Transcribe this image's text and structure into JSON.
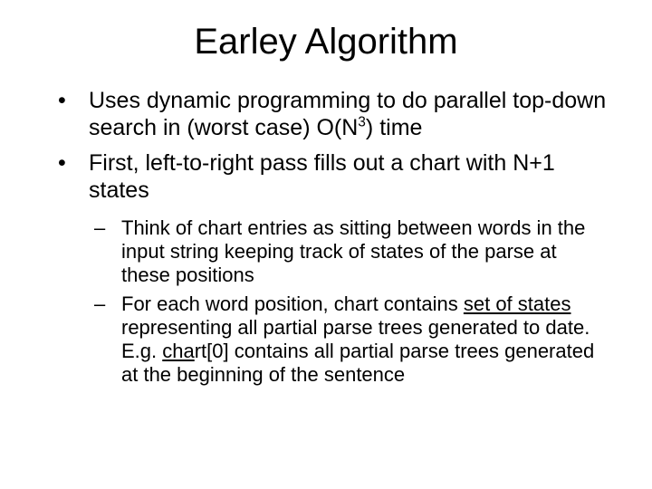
{
  "title": "Earley Algorithm",
  "bullets": [
    {
      "pre": "Uses dynamic programming to do parallel top-down search in  (worst case) O(N",
      "sup": "3",
      "post": ") time"
    },
    {
      "text": "First, left-to-right pass fills out a chart with N+1 states",
      "sub": [
        {
          "text": "Think of chart entries as sitting between words in the input string keeping track of states of the parse at these positions"
        },
        {
          "a": "For each word position, chart contains ",
          "u1": "set of states ",
          "b": "representing all partial parse trees generated to date. E.g. ",
          "u2": "cha",
          "c": "rt[0] contains all partial parse trees generated at the beginning of the sentence"
        }
      ]
    }
  ]
}
